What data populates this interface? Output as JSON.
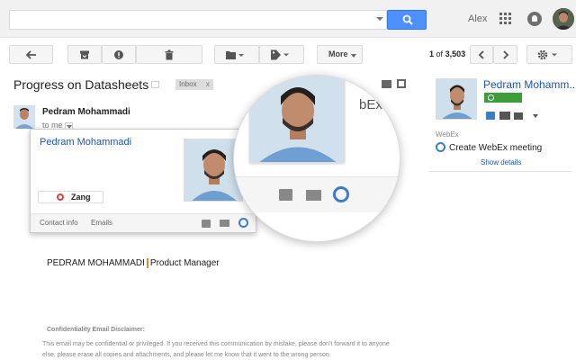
{
  "header": {
    "search_placeholder": "",
    "user_name": "Alex"
  },
  "toolbar": {
    "more_label": "More",
    "count_range": "1",
    "count_of": "of",
    "count_total": "3,503"
  },
  "email": {
    "subject": "Progress on Datasheets",
    "label": "Inbox",
    "label_remove": "x",
    "sender_name": "Pedram Mohammadi",
    "to_text": "to me",
    "signature_name": "PEDRAM MOHAMMADI",
    "signature_title": "Product Manager",
    "disclaimer_title": "Confidentiality Email Disclaimer:",
    "disclaimer_text": "This email may be confidential or privileged. If you received this communication by mistake, please don't forward it to anyone else, please erase all copies and attachments, and please let me know that it went to the wrong person."
  },
  "hovercard": {
    "name": "Pedram Mohammadi",
    "zang_label": "Zang",
    "contact_info": "Contact info",
    "emails": "Emails"
  },
  "magnifier": {
    "partial_text": "bEx"
  },
  "sidebar": {
    "name": "Pedram Mohamm...",
    "section_title": "WebEx",
    "webex_action": "Create WebEx meeting",
    "show_details": "Show details"
  },
  "colors": {
    "accent_blue": "#4d90fe",
    "link_blue": "#1a55bd",
    "status_green": "#3b9e3b",
    "zang_red": "#e0423a",
    "webex_blue": "#3b7ec8"
  }
}
